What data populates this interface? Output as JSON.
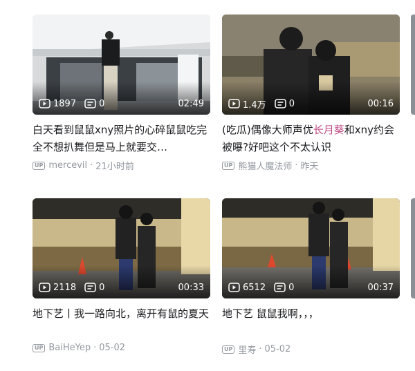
{
  "cards": [
    {
      "views": "1897",
      "comments": "0",
      "duration": "02:49",
      "title_pre": "白天看到鼠鼠xny照片的心碎鼠鼠吃完全不想扒舞但是马上就要交…",
      "title_hl": "",
      "title_post": "",
      "author": "mercevil",
      "time": "21小时前"
    },
    {
      "views": "1.4万",
      "comments": "0",
      "duration": "00:16",
      "title_pre": "(吃瓜)偶像大师声优",
      "title_hl": "长月葵",
      "title_post": "和xny约会被曝?好吧这个不太认识",
      "author": "熊猫人魔法师",
      "time": "昨天"
    },
    {
      "views": "2118",
      "comments": "0",
      "duration": "00:33",
      "title_pre": "地下艺丨我一路向北，离开有鼠的夏天",
      "title_hl": "",
      "title_post": "",
      "author": "BaiHeYep",
      "time": "05-02"
    },
    {
      "views": "6512",
      "comments": "0",
      "duration": "00:37",
      "title_pre": "地下艺 鼠鼠我啊，，，",
      "title_hl": "",
      "title_post": "",
      "author": "里寿",
      "time": "05-02"
    }
  ],
  "up_badge": "UP",
  "meta_sep": "·",
  "colors": {
    "highlight": "#c04f86",
    "meta": "#9499a0",
    "title": "#18191c"
  },
  "icons": {
    "views": "play-count-icon",
    "comments": "danmaku-icon",
    "uploader": "up-badge-icon"
  }
}
